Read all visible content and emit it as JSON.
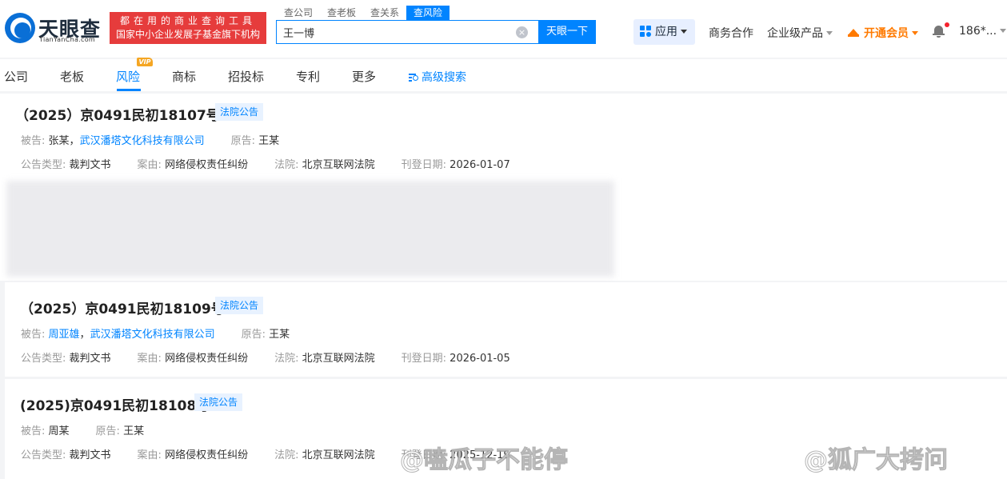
{
  "brand": {
    "name": "天眼查",
    "domain": "TianYanCha.com",
    "slogan_line1": "都在用的商业查询工具",
    "slogan_line2": "国家中小企业发展子基金旗下机构"
  },
  "search": {
    "tabs": [
      {
        "label": "查公司",
        "active": false
      },
      {
        "label": "查老板",
        "active": false
      },
      {
        "label": "查关系",
        "active": false
      },
      {
        "label": "查风险",
        "active": true
      }
    ],
    "query": "王一博",
    "button_label": "天眼一下"
  },
  "header_nav": {
    "app_label": "应用",
    "business": "商务合作",
    "enterprise": "企业级产品",
    "vip": "开通会员",
    "user": "186*..."
  },
  "subnav": {
    "items": [
      "公司",
      "老板",
      "风险",
      "商标",
      "招投标",
      "专利",
      "更多"
    ],
    "active_index": 2,
    "vip_badge": "VIP",
    "advanced_search": "高级搜索"
  },
  "labels": {
    "defendant": "被告:",
    "plaintiff": "原告:",
    "type": "公告类型:",
    "cause": "案由:",
    "court": "法院:",
    "date": "刊登日期:"
  },
  "results": [
    {
      "title": "（2025）京0491民初18107号",
      "tag": "法院公告",
      "defendants": [
        {
          "name": "张某",
          "link": false
        },
        {
          "name": "武汉潘塔文化科技有限公司",
          "link": true
        }
      ],
      "plaintiff": "王某",
      "type": "裁判文书",
      "cause": "网络侵权责任纠纷",
      "court": "北京互联网法院",
      "date": "2026-01-07"
    },
    {
      "title": "（2025）京0491民初18109号",
      "tag": "法院公告",
      "defendants": [
        {
          "name": "周亚雄",
          "link": true
        },
        {
          "name": "武汉潘塔文化科技有限公司",
          "link": true
        }
      ],
      "plaintiff": "王某",
      "type": "裁判文书",
      "cause": "网络侵权责任纠纷",
      "court": "北京互联网法院",
      "date": "2026-01-05"
    },
    {
      "title": "(2025)京0491民初18108号",
      "tag": "法院公告",
      "defendants": [
        {
          "name": "周某",
          "link": false
        }
      ],
      "plaintiff": "王某",
      "type": "裁判文书",
      "cause": "网络侵权责任纠纷",
      "court": "北京互联网法院",
      "date": "2025-12-19"
    }
  ],
  "watermarks": [
    "@嗑瓜子不能停",
    "@狐广大拷问"
  ],
  "colors": {
    "accent": "#0084ff",
    "brand_red": "#e63c3c",
    "vip_orange": "#ff7a00"
  }
}
